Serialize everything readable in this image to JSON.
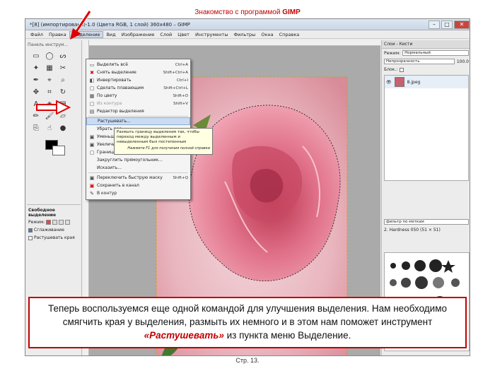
{
  "slide": {
    "title_prefix": "Знакомство с программой ",
    "title_bold": "GIMP",
    "caption_before": "Теперь воспользуемся еще одной командой для улучшения выделения. Нам необходимо смягчить края у выделения, размыть их немного и в этом нам поможет инструмент ",
    "caption_em": "«Растушевать»",
    "caption_after": " из пункта меню Выделение.",
    "page_number": "Стр. 13."
  },
  "window": {
    "title": "*[8] (импортировано)-1.0 (Цвета RGB, 1 слой) 360x480 – GIMP",
    "btn_min": "–",
    "btn_max": "□",
    "btn_close": "✕"
  },
  "menubar": [
    "Файл",
    "Правка",
    "Выделение",
    "Вид",
    "Изображение",
    "Слой",
    "Цвет",
    "Инструменты",
    "Фильтры",
    "Окна",
    "Справка"
  ],
  "toolbox": {
    "title": "Панель инструм...",
    "options_title": "Свободное выделение",
    "mode_label": "Режим:",
    "antialias_label": "Сглаживание",
    "feather_label": "Растушевать края"
  },
  "selection_menu": {
    "items": [
      {
        "icon": "▭",
        "label": "Выделить всё",
        "shortcut": "Ctrl+A"
      },
      {
        "icon": "✖",
        "label": "Снять выделение",
        "shortcut": "Shift+Ctrl+A"
      },
      {
        "icon": "◧",
        "label": "Инвертировать",
        "shortcut": "Ctrl+I"
      },
      {
        "icon": "▢",
        "label": "Сделать плавающим",
        "shortcut": "Shift+Ctrl+L"
      },
      {
        "icon": "▦",
        "label": "По цвету",
        "shortcut": "Shift+O"
      },
      {
        "icon": "▢",
        "label": "Из контура",
        "shortcut": "Shift+V"
      },
      {
        "icon": "▤",
        "label": "Редактор выделения",
        "shortcut": ""
      },
      {
        "icon": "",
        "label": "Растушевать...",
        "shortcut": ""
      },
      {
        "icon": "",
        "label": "Убрать рас...",
        "shortcut": ""
      },
      {
        "icon": "▣",
        "label": "Уменьшить...",
        "shortcut": ""
      },
      {
        "icon": "▣",
        "label": "Увеличить...",
        "shortcut": ""
      },
      {
        "icon": "▢",
        "label": "Граница...",
        "shortcut": ""
      },
      {
        "icon": "",
        "label": "Закруглить прямоугольник...",
        "shortcut": ""
      },
      {
        "icon": "",
        "label": "Исказить...",
        "shortcut": ""
      },
      {
        "icon": "▣",
        "label": "Переключить быструю маску",
        "shortcut": "Shift+Q"
      },
      {
        "icon": "▣",
        "label": "Сохранить в канал",
        "shortcut": ""
      },
      {
        "icon": "✎",
        "label": "В контур",
        "shortcut": ""
      }
    ]
  },
  "tooltip": {
    "text": "Размыть границу выделения так, чтобы переход между выделенным и невыделенным был постепенным",
    "hint": "Нажмите F1 для получения полной справки"
  },
  "right_panel": {
    "title": "Слои - Кисти",
    "mode_label": "Режим:",
    "mode_value": "Нормальный",
    "opacity_label": "Непрозрачность",
    "opacity_value": "100.0",
    "lock_label": "Блок.:",
    "layer_name": "8.jpeg",
    "brush_filter_placeholder": "фильтр по меткам",
    "brush_name": "2. Hardness 050 (51 × 51)"
  },
  "colors": {
    "accent_red": "#c00000",
    "menu_highlight": "#cbdcf2"
  }
}
